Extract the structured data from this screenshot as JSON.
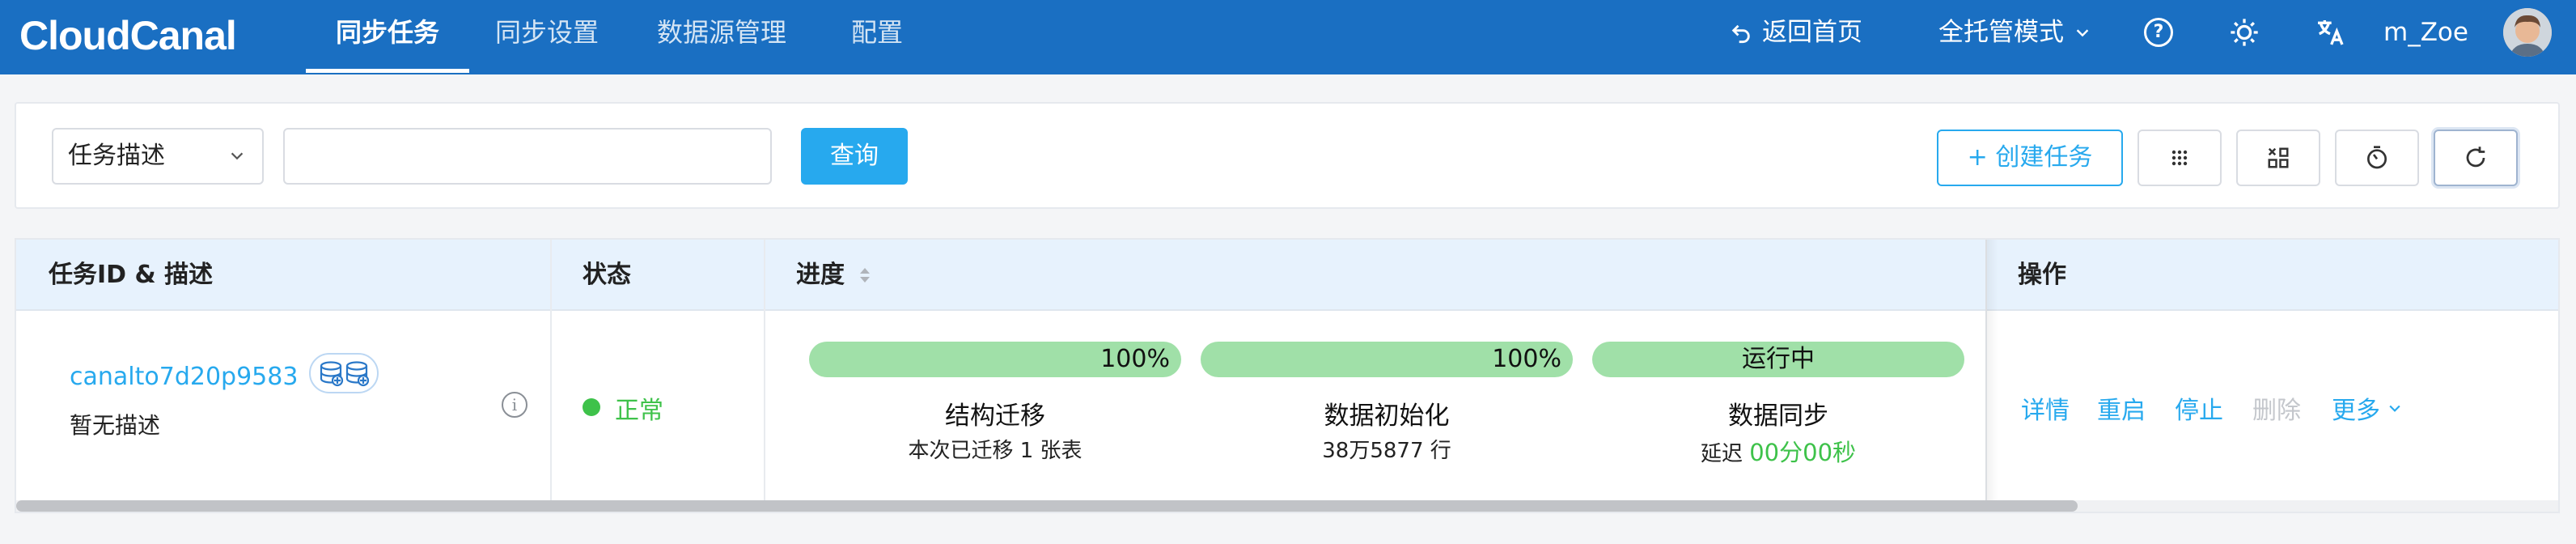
{
  "header": {
    "logo": "CloudCanal",
    "nav": [
      {
        "label": "同步任务",
        "active": true
      },
      {
        "label": "同步设置",
        "active": false
      },
      {
        "label": "数据源管理",
        "active": false
      },
      {
        "label": "配置",
        "active": false
      }
    ],
    "back_home": "返回首页",
    "mode": "全托管模式",
    "help_icon": "?",
    "username": "m_Zoe"
  },
  "search": {
    "field_select": "任务描述",
    "input_value": "",
    "input_placeholder": "",
    "query_label": "查询",
    "create_label": "+ 创建任务"
  },
  "table": {
    "columns": {
      "task_id": "任务ID & 描述",
      "status": "状态",
      "progress": "进度",
      "actions": "操作"
    },
    "rows": [
      {
        "task_id": "canalto7d20p9583",
        "description": "暂无描述",
        "status": "正常",
        "stages": [
          {
            "bar_text": "100%",
            "progress": 1.0,
            "name": "结构迁移",
            "detail": "本次已迁移 1 张表"
          },
          {
            "bar_text": "100%",
            "progress": 1.0,
            "name": "数据初始化",
            "detail": "38万5877 行"
          },
          {
            "bar_text": "运行中",
            "progress": 1.0,
            "name": "数据同步",
            "delay_label": "延迟",
            "delay_value": "00分00秒"
          }
        ],
        "actions": {
          "detail": "详情",
          "restart": "重启",
          "stop": "停止",
          "delete": "删除",
          "more": "更多"
        }
      }
    ]
  },
  "colors": {
    "brand": "#1a6fc2",
    "accent": "#27a9ee",
    "success": "#3ec24a",
    "bar_fill": "#a0e0a8",
    "header_row": "#e7f2fd"
  },
  "icons": [
    "undo-arrow-icon",
    "chevron-down-icon",
    "help-icon",
    "sun-icon",
    "translate-icon",
    "grid-icon",
    "layout-icon",
    "timer-icon",
    "refresh-icon",
    "database-icon",
    "info-icon"
  ]
}
